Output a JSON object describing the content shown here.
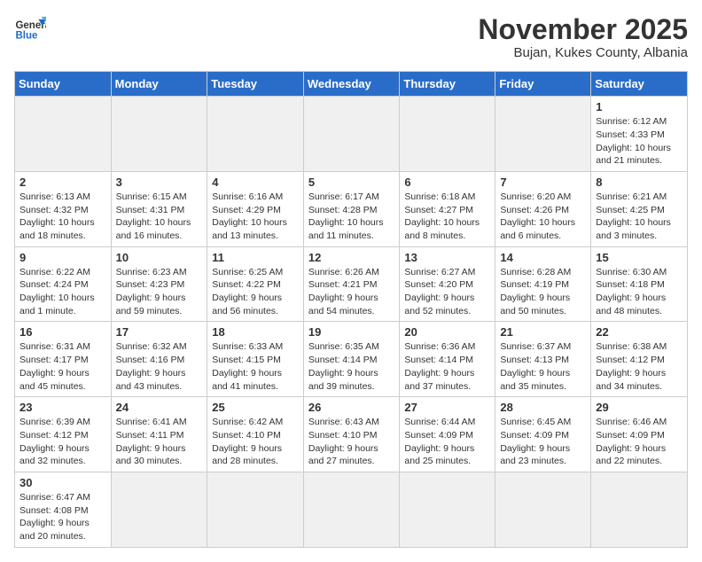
{
  "logo": {
    "line1": "General",
    "line2": "Blue"
  },
  "title": "November 2025",
  "subtitle": "Bujan, Kukes County, Albania",
  "days_of_week": [
    "Sunday",
    "Monday",
    "Tuesday",
    "Wednesday",
    "Thursday",
    "Friday",
    "Saturday"
  ],
  "weeks": [
    [
      {
        "day": "",
        "info": ""
      },
      {
        "day": "",
        "info": ""
      },
      {
        "day": "",
        "info": ""
      },
      {
        "day": "",
        "info": ""
      },
      {
        "day": "",
        "info": ""
      },
      {
        "day": "",
        "info": ""
      },
      {
        "day": "1",
        "info": "Sunrise: 6:12 AM\nSunset: 4:33 PM\nDaylight: 10 hours and 21 minutes."
      }
    ],
    [
      {
        "day": "2",
        "info": "Sunrise: 6:13 AM\nSunset: 4:32 PM\nDaylight: 10 hours and 18 minutes."
      },
      {
        "day": "3",
        "info": "Sunrise: 6:15 AM\nSunset: 4:31 PM\nDaylight: 10 hours and 16 minutes."
      },
      {
        "day": "4",
        "info": "Sunrise: 6:16 AM\nSunset: 4:29 PM\nDaylight: 10 hours and 13 minutes."
      },
      {
        "day": "5",
        "info": "Sunrise: 6:17 AM\nSunset: 4:28 PM\nDaylight: 10 hours and 11 minutes."
      },
      {
        "day": "6",
        "info": "Sunrise: 6:18 AM\nSunset: 4:27 PM\nDaylight: 10 hours and 8 minutes."
      },
      {
        "day": "7",
        "info": "Sunrise: 6:20 AM\nSunset: 4:26 PM\nDaylight: 10 hours and 6 minutes."
      },
      {
        "day": "8",
        "info": "Sunrise: 6:21 AM\nSunset: 4:25 PM\nDaylight: 10 hours and 3 minutes."
      }
    ],
    [
      {
        "day": "9",
        "info": "Sunrise: 6:22 AM\nSunset: 4:24 PM\nDaylight: 10 hours and 1 minute."
      },
      {
        "day": "10",
        "info": "Sunrise: 6:23 AM\nSunset: 4:23 PM\nDaylight: 9 hours and 59 minutes."
      },
      {
        "day": "11",
        "info": "Sunrise: 6:25 AM\nSunset: 4:22 PM\nDaylight: 9 hours and 56 minutes."
      },
      {
        "day": "12",
        "info": "Sunrise: 6:26 AM\nSunset: 4:21 PM\nDaylight: 9 hours and 54 minutes."
      },
      {
        "day": "13",
        "info": "Sunrise: 6:27 AM\nSunset: 4:20 PM\nDaylight: 9 hours and 52 minutes."
      },
      {
        "day": "14",
        "info": "Sunrise: 6:28 AM\nSunset: 4:19 PM\nDaylight: 9 hours and 50 minutes."
      },
      {
        "day": "15",
        "info": "Sunrise: 6:30 AM\nSunset: 4:18 PM\nDaylight: 9 hours and 48 minutes."
      }
    ],
    [
      {
        "day": "16",
        "info": "Sunrise: 6:31 AM\nSunset: 4:17 PM\nDaylight: 9 hours and 45 minutes."
      },
      {
        "day": "17",
        "info": "Sunrise: 6:32 AM\nSunset: 4:16 PM\nDaylight: 9 hours and 43 minutes."
      },
      {
        "day": "18",
        "info": "Sunrise: 6:33 AM\nSunset: 4:15 PM\nDaylight: 9 hours and 41 minutes."
      },
      {
        "day": "19",
        "info": "Sunrise: 6:35 AM\nSunset: 4:14 PM\nDaylight: 9 hours and 39 minutes."
      },
      {
        "day": "20",
        "info": "Sunrise: 6:36 AM\nSunset: 4:14 PM\nDaylight: 9 hours and 37 minutes."
      },
      {
        "day": "21",
        "info": "Sunrise: 6:37 AM\nSunset: 4:13 PM\nDaylight: 9 hours and 35 minutes."
      },
      {
        "day": "22",
        "info": "Sunrise: 6:38 AM\nSunset: 4:12 PM\nDaylight: 9 hours and 34 minutes."
      }
    ],
    [
      {
        "day": "23",
        "info": "Sunrise: 6:39 AM\nSunset: 4:12 PM\nDaylight: 9 hours and 32 minutes."
      },
      {
        "day": "24",
        "info": "Sunrise: 6:41 AM\nSunset: 4:11 PM\nDaylight: 9 hours and 30 minutes."
      },
      {
        "day": "25",
        "info": "Sunrise: 6:42 AM\nSunset: 4:10 PM\nDaylight: 9 hours and 28 minutes."
      },
      {
        "day": "26",
        "info": "Sunrise: 6:43 AM\nSunset: 4:10 PM\nDaylight: 9 hours and 27 minutes."
      },
      {
        "day": "27",
        "info": "Sunrise: 6:44 AM\nSunset: 4:09 PM\nDaylight: 9 hours and 25 minutes."
      },
      {
        "day": "28",
        "info": "Sunrise: 6:45 AM\nSunset: 4:09 PM\nDaylight: 9 hours and 23 minutes."
      },
      {
        "day": "29",
        "info": "Sunrise: 6:46 AM\nSunset: 4:09 PM\nDaylight: 9 hours and 22 minutes."
      }
    ],
    [
      {
        "day": "30",
        "info": "Sunrise: 6:47 AM\nSunset: 4:08 PM\nDaylight: 9 hours and 20 minutes."
      },
      {
        "day": "",
        "info": ""
      },
      {
        "day": "",
        "info": ""
      },
      {
        "day": "",
        "info": ""
      },
      {
        "day": "",
        "info": ""
      },
      {
        "day": "",
        "info": ""
      },
      {
        "day": "",
        "info": ""
      }
    ]
  ]
}
